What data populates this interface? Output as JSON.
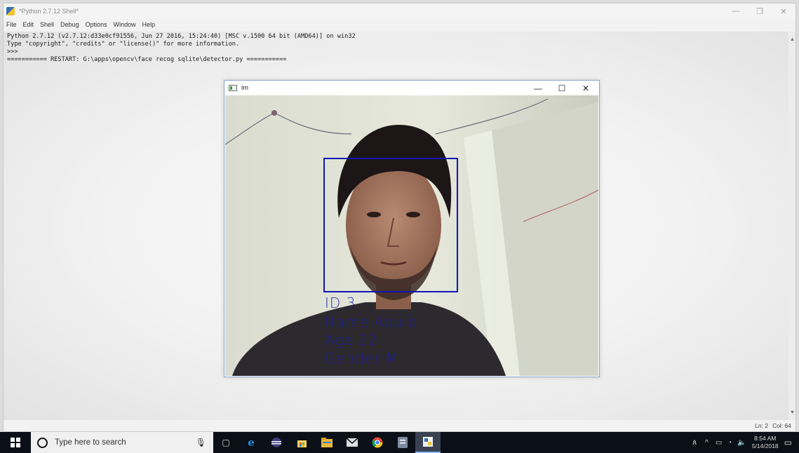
{
  "shell": {
    "title": "*Python 2.7.12 Shell*",
    "controls": {
      "minimize": "—",
      "restore": "❐",
      "close": "✕"
    },
    "menu": [
      "File",
      "Edit",
      "Shell",
      "Debug",
      "Options",
      "Window",
      "Help"
    ],
    "lines": [
      "Python 2.7.12 (v2.7.12:d33e0cf91556, Jun 27 2016, 15:24:40) [MSC v.1500 64 bit (AMD64)] on win32",
      "Type \"copyright\", \"credits\" or \"license()\" for more information.",
      ">>> ",
      "=========== RESTART: G:\\apps\\opencv\\face recog sqlite\\detector.py ==========="
    ],
    "status": {
      "line": "Ln: 2",
      "col": "Col: 64"
    }
  },
  "im_window": {
    "title": "im",
    "controls": {
      "minimize": "—",
      "maximize": "☐",
      "close": "✕"
    },
    "overlay": {
      "id": "ID 3",
      "name": "Name Aquib",
      "age": "Age 22",
      "gender": "Gender M"
    },
    "box_color": "#1414b4"
  },
  "taskbar": {
    "search_placeholder": "Type here to search",
    "clock_time": "8:54 AM",
    "clock_date": "5/14/2018",
    "pinned": [
      "task-view-icon",
      "edge-icon",
      "eclipse-icon",
      "store-icon",
      "file-explorer-icon",
      "mail-icon",
      "chrome-icon",
      "notes-icon",
      "python-idle-icon"
    ]
  }
}
